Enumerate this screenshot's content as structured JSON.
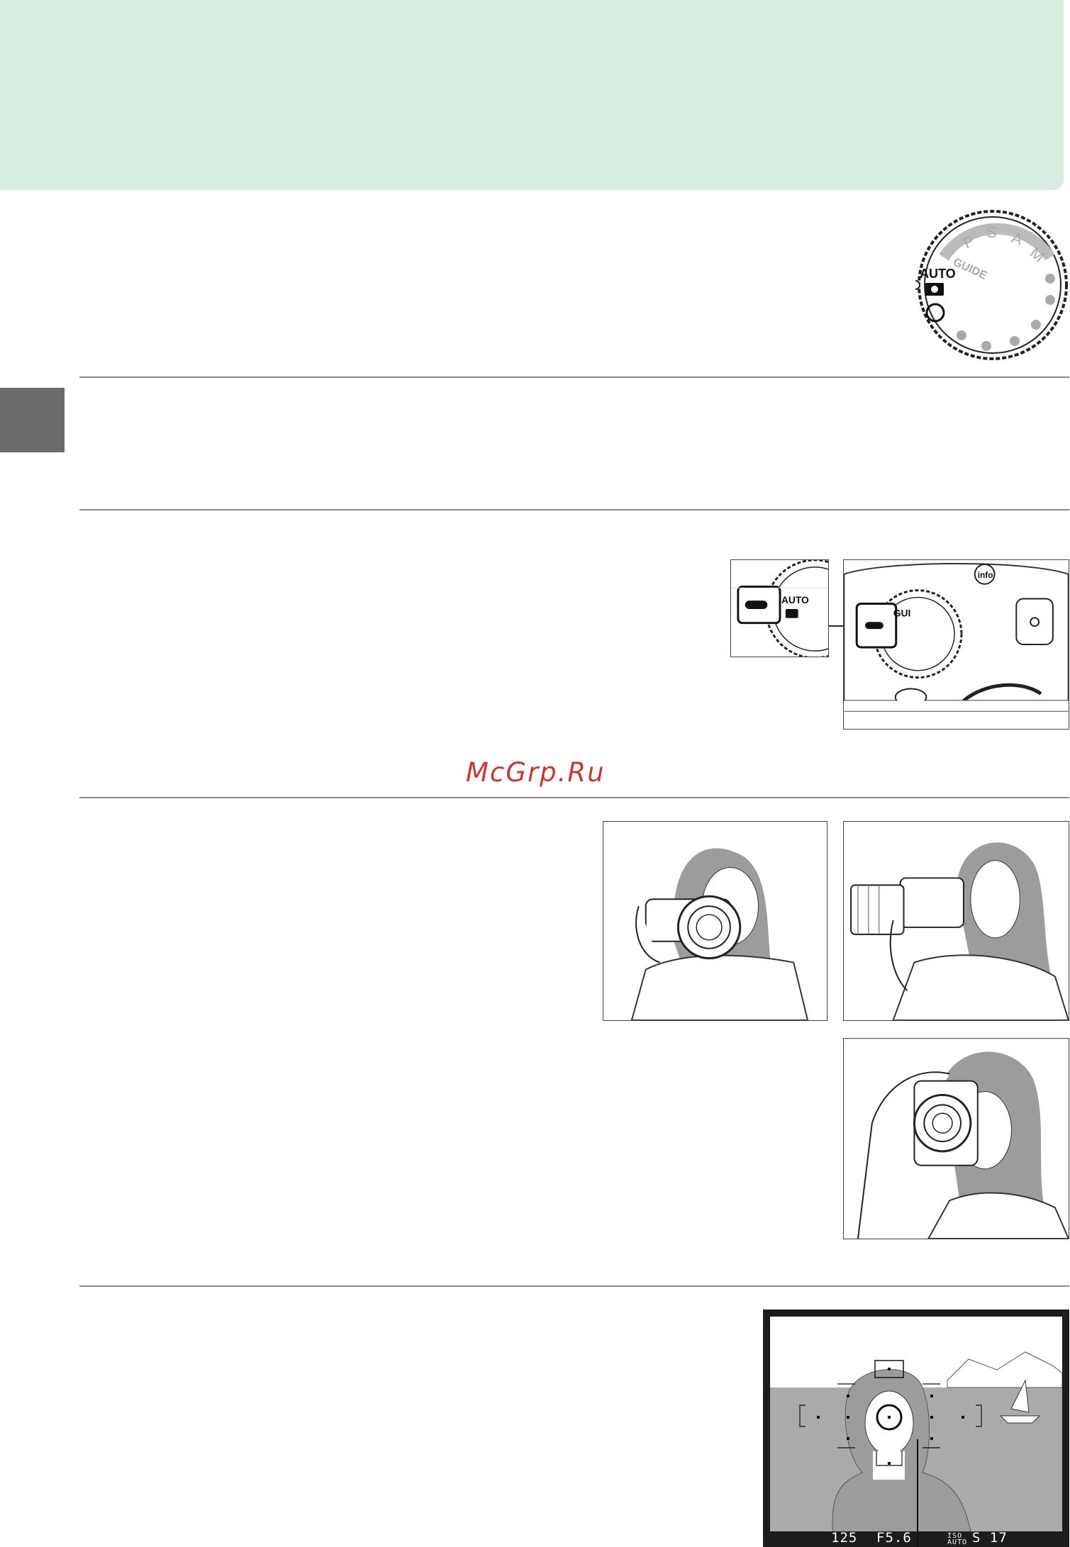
{
  "watermark": "McGrp.Ru",
  "dial": {
    "labels": [
      "P",
      "S",
      "A",
      "M",
      "GUIDE",
      "AUTO"
    ]
  },
  "camera_top": {
    "small_labels": [
      "AUTO",
      "GUI",
      "info"
    ]
  },
  "viewfinder": {
    "shutter": "125",
    "aperture": "F5.6",
    "iso_label": "ISO AUTO",
    "frames": "S 17"
  },
  "colors": {
    "header_band": "#d8ecdf",
    "side_tab": "#6b6b6b",
    "watermark": "#c23a34"
  }
}
